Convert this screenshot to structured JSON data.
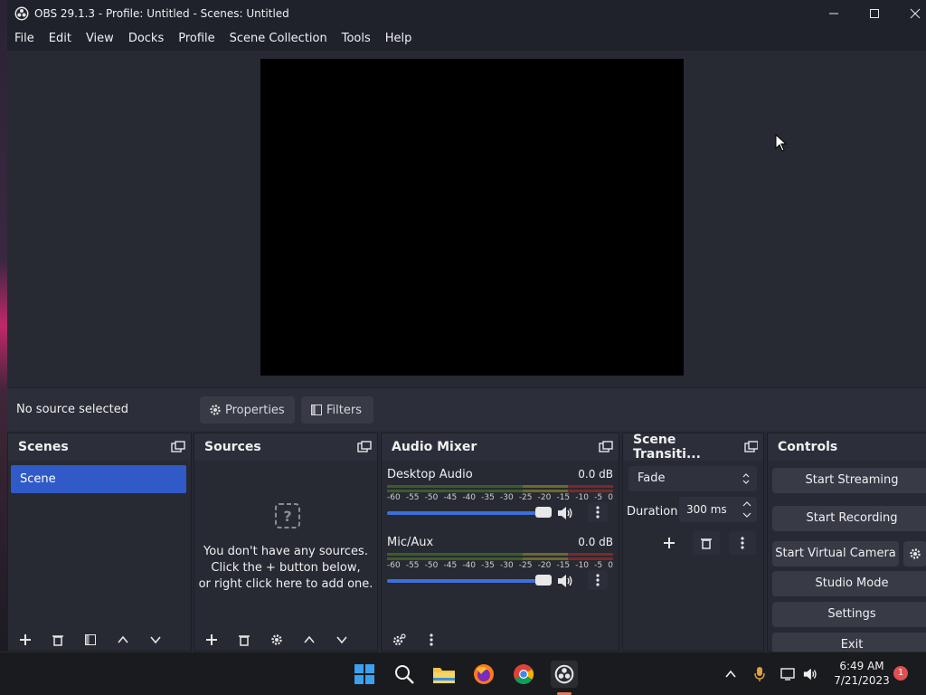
{
  "window": {
    "title": "OBS 29.1.3 - Profile: Untitled - Scenes: Untitled",
    "minimize_label": "—",
    "maximize_label": "☐",
    "close_label": "✕"
  },
  "menu": {
    "items": [
      "File",
      "Edit",
      "View",
      "Docks",
      "Profile",
      "Scene Collection",
      "Tools",
      "Help"
    ]
  },
  "context": {
    "no_source": "No source selected",
    "properties_label": "Properties",
    "filters_label": "Filters"
  },
  "docks": {
    "scenes": {
      "title": "Scenes",
      "items": [
        "Scene"
      ]
    },
    "sources": {
      "title": "Sources",
      "empty_line1": "You don't have any sources.",
      "empty_line2": "Click the + button below,",
      "empty_line3": "or right click here to add one."
    },
    "mixer": {
      "title": "Audio Mixer",
      "scale": [
        "-60",
        "-55",
        "-50",
        "-45",
        "-40",
        "-35",
        "-30",
        "-25",
        "-20",
        "-15",
        "-10",
        "-5",
        "0"
      ],
      "channels": [
        {
          "name": "Desktop Audio",
          "db": "0.0 dB"
        },
        {
          "name": "Mic/Aux",
          "db": "0.0 dB"
        }
      ]
    },
    "transitions": {
      "title": "Scene Transiti...",
      "type": "Fade",
      "duration_label": "Duration",
      "duration_value": "300 ms"
    },
    "controls": {
      "title": "Controls",
      "start_streaming": "Start Streaming",
      "start_recording": "Start Recording",
      "start_virtual_camera": "Start Virtual Camera",
      "studio_mode": "Studio Mode",
      "settings": "Settings",
      "exit": "Exit"
    }
  },
  "taskbar": {
    "time": "6:49 AM",
    "date": "7/21/2023",
    "notification_count": "1"
  },
  "colors": {
    "accent": "#2f5ac8",
    "slider": "#3d6fd8",
    "window_bg": "#272a33"
  }
}
